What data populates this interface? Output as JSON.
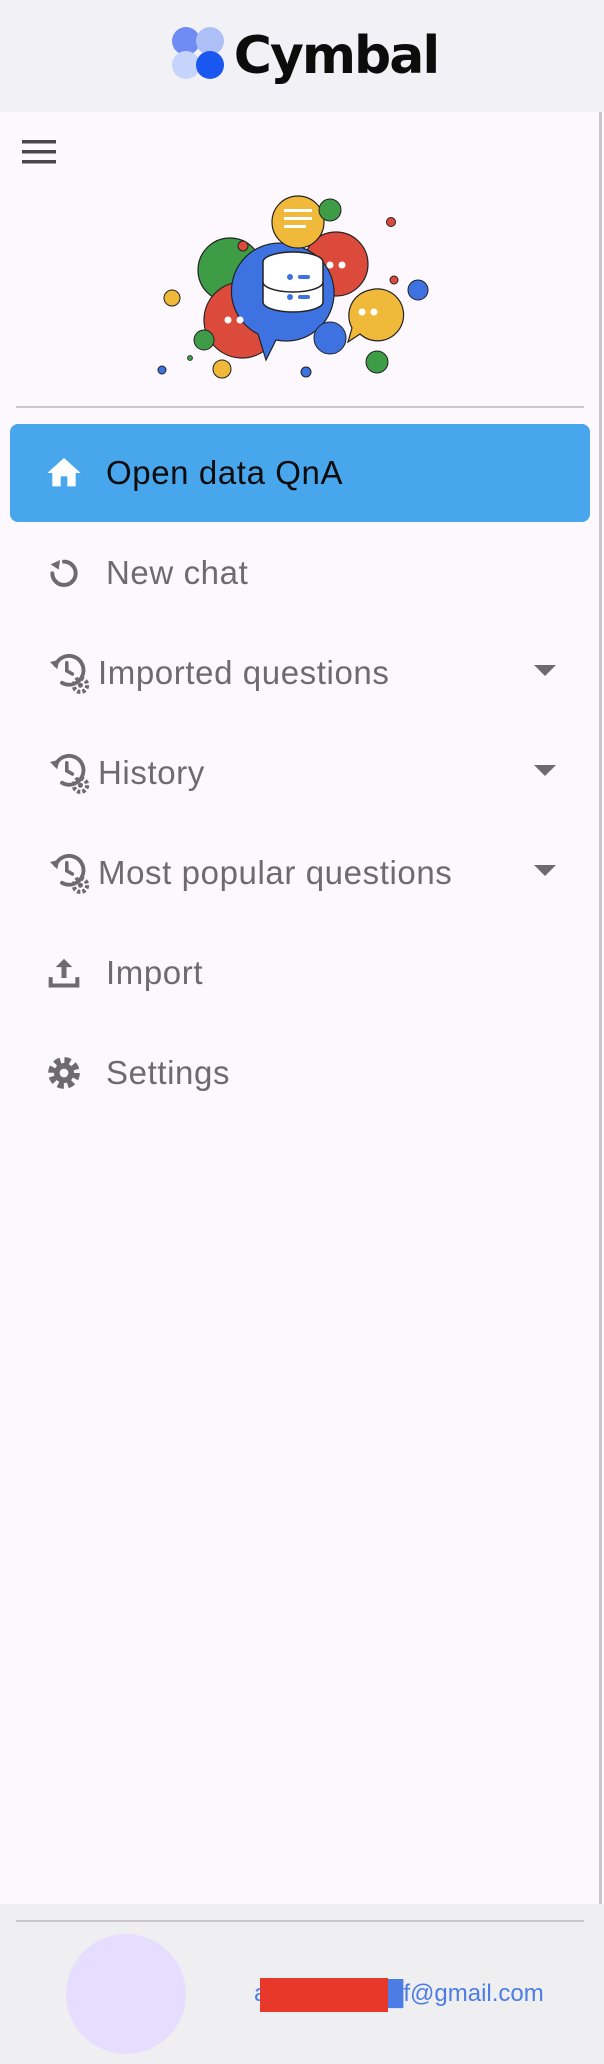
{
  "header": {
    "brand": "Cymbal"
  },
  "nav": {
    "items": [
      {
        "label": "Open data QnA",
        "icon": "home-icon",
        "active": true,
        "expandable": false
      },
      {
        "label": "New chat",
        "icon": "refresh-icon",
        "active": false,
        "expandable": false
      },
      {
        "label": "Imported questions",
        "icon": "history-settings-icon",
        "active": false,
        "expandable": true
      },
      {
        "label": "History",
        "icon": "history-settings-icon",
        "active": false,
        "expandable": true
      },
      {
        "label": "Most popular questions",
        "icon": "history-settings-icon",
        "active": false,
        "expandable": true
      },
      {
        "label": "Import",
        "icon": "upload-icon",
        "active": false,
        "expandable": false
      },
      {
        "label": "Settings",
        "icon": "gear-icon",
        "active": false,
        "expandable": false
      }
    ]
  },
  "user": {
    "email": "a████████f@gmail.com"
  },
  "colors": {
    "active": "#48a6ec",
    "drawer_bg": "#fdf8fd",
    "footer_bg": "#efeff1",
    "link": "#4c7de6",
    "redaction": "#e8382a"
  }
}
